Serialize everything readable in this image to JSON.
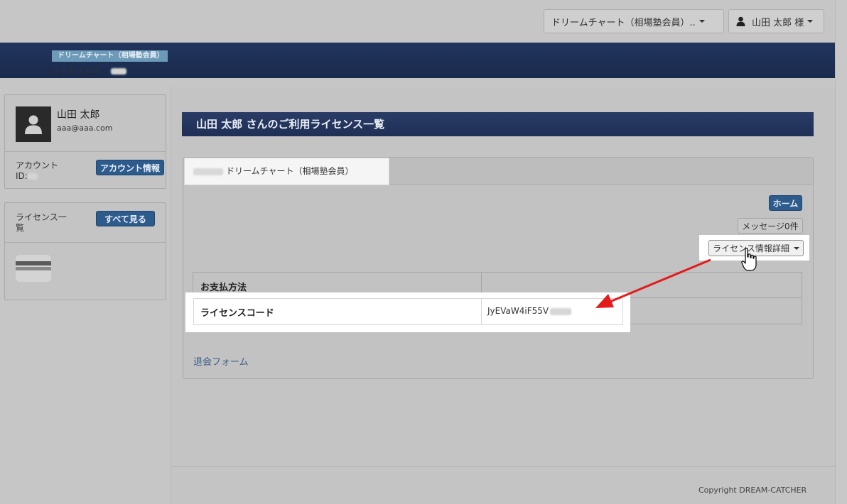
{
  "topbar": {
    "product_dropdown": "ドリームチャート（相場塾会員）..",
    "user_dropdown": "山田 太郎 様"
  },
  "sidebar": {
    "profile": {
      "name": "山田 太郎",
      "email": "aaa@aaa.com",
      "account_label": "アカウント",
      "id_label": "ID:",
      "account_button": "アカウント情報"
    },
    "licenses": {
      "title": "ライセンス一覧",
      "view_all_button": "すべて見る",
      "item_name": "ドリームチャート（相場塾会員）",
      "item_id_label": "ライセンスID："
    }
  },
  "main": {
    "page_title": "山田 太郎 さんのご利用ライセンス一覧",
    "tab_label": "ドリームチャート（相場塾会員）",
    "home_button": "ホーム",
    "message_button": "メッセージ0件",
    "license_detail_button": "ライセンス情報詳細",
    "table": {
      "rows": [
        {
          "label": "お支払方法",
          "value": ""
        },
        {
          "label": "ライセンスコード",
          "value": "JyEVaW4iF55V"
        }
      ]
    },
    "withdraw_link": "退会フォーム"
  },
  "footer": {
    "copyright": "Copyright DREAM-CATCHER"
  },
  "colors": {
    "brand_navy": "#1f2f55",
    "button_blue": "#2d5b8c",
    "annotation_arrow": "#e31b1b"
  },
  "icons": [
    "user-icon",
    "caret-down-icon",
    "hand-cursor-icon",
    "red-arrow"
  ]
}
